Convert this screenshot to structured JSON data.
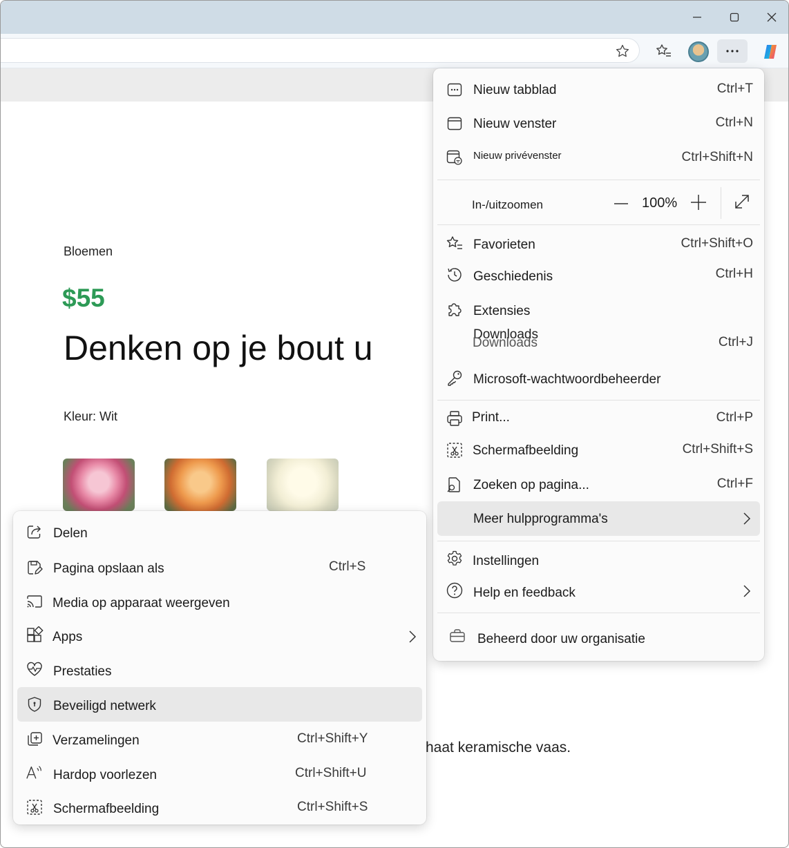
{
  "main_menu": {
    "items": [
      {
        "label": "Nieuw tabblad",
        "shortcut": "Ctrl+T"
      },
      {
        "label": "Nieuw venster",
        "shortcut": "Ctrl+N"
      },
      {
        "label": "Nieuw privévenster",
        "shortcut": "Ctrl+Shift+N"
      },
      {
        "label": "Favorieten",
        "shortcut": "Ctrl+Shift+O"
      },
      {
        "label": "Geschiedenis",
        "shortcut": "Ctrl+H"
      },
      {
        "label": "Extensies",
        "shortcut": ""
      },
      {
        "label": "Downloads",
        "shortcut": "Ctrl+J"
      },
      {
        "label": "Microsoft-wachtwoordbeheerder",
        "shortcut": ""
      },
      {
        "label": "Print...",
        "shortcut": "Ctrl+P"
      },
      {
        "label": "Schermafbeelding",
        "shortcut": "Ctrl+Shift+S"
      },
      {
        "label": "Zoeken op pagina...",
        "shortcut": "Ctrl+F"
      },
      {
        "label": "Meer hulpprogramma's",
        "shortcut": ""
      },
      {
        "label": "Instellingen",
        "shortcut": ""
      },
      {
        "label": "Help en feedback",
        "shortcut": ""
      }
    ],
    "zoom": {
      "label": "In-/uitzoomen",
      "value": "100%"
    },
    "managed": "Beheerd door uw organisatie"
  },
  "sub_menu": {
    "items": [
      {
        "label": "Delen",
        "shortcut": ""
      },
      {
        "label": "Pagina opslaan als",
        "shortcut": "Ctrl+S"
      },
      {
        "label": "Media op apparaat weergeven",
        "shortcut": ""
      },
      {
        "label": "Apps",
        "shortcut": ""
      },
      {
        "label": "Prestaties",
        "shortcut": ""
      },
      {
        "label": "Beveiligd netwerk",
        "shortcut": ""
      },
      {
        "label": "Verzamelingen",
        "shortcut": "Ctrl+Shift+Y"
      },
      {
        "label": "Hardop voorlezen",
        "shortcut": "Ctrl+Shift+U"
      },
      {
        "label": "Schermafbeelding",
        "shortcut": "Ctrl+Shift+S"
      }
    ]
  },
  "page": {
    "category": "Bloemen",
    "price": "$55",
    "headline": "Denken op je bout u",
    "color_label": "Kleur: Wit",
    "description": "haat keramische vaas."
  },
  "colors": {
    "price_green": "#2d9a56",
    "titlebar": "#cfdce6",
    "highlight": "#e8e8e8"
  }
}
